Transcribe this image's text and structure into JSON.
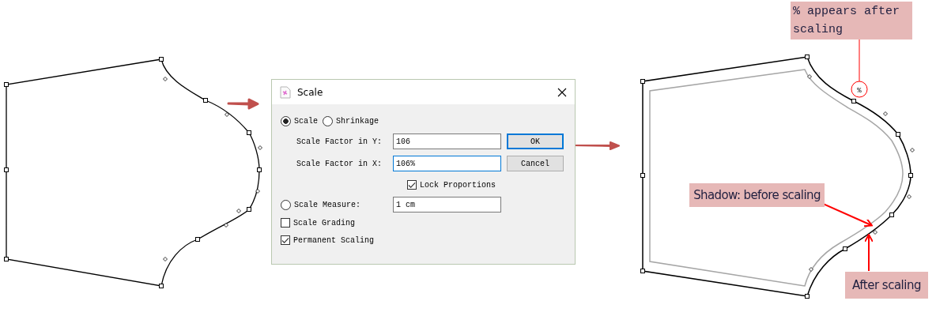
{
  "dialog": {
    "title": "Scale",
    "mode_options": [
      {
        "label": "Scale",
        "selected": true
      },
      {
        "label": "Shrinkage",
        "selected": false
      }
    ],
    "fields": [
      {
        "label": "Scale Factor in Y:",
        "value": "106",
        "focused": false
      },
      {
        "label": "Scale Factor in X:",
        "value": "106%",
        "focused": true
      }
    ],
    "buttons": [
      {
        "label": "OK",
        "default": true
      },
      {
        "label": "Cancel",
        "default": false
      }
    ],
    "lock_proportions": {
      "label": "Lock Proportions",
      "checked": true
    },
    "scale_measure": {
      "label": "Scale Measure:",
      "selected": false,
      "value": "1 cm"
    },
    "options": [
      {
        "label": "Scale Grading",
        "checked": false
      },
      {
        "label": "Permanent Scaling",
        "checked": true
      }
    ]
  },
  "marker_label": "%",
  "annotations": [
    {
      "kind": "circle-leader",
      "text": "% appears after scaling"
    },
    {
      "kind": "diagonal-arrow",
      "text": "Shadow: before scaling"
    },
    {
      "kind": "up-arrow",
      "text": "After scaling"
    }
  ]
}
